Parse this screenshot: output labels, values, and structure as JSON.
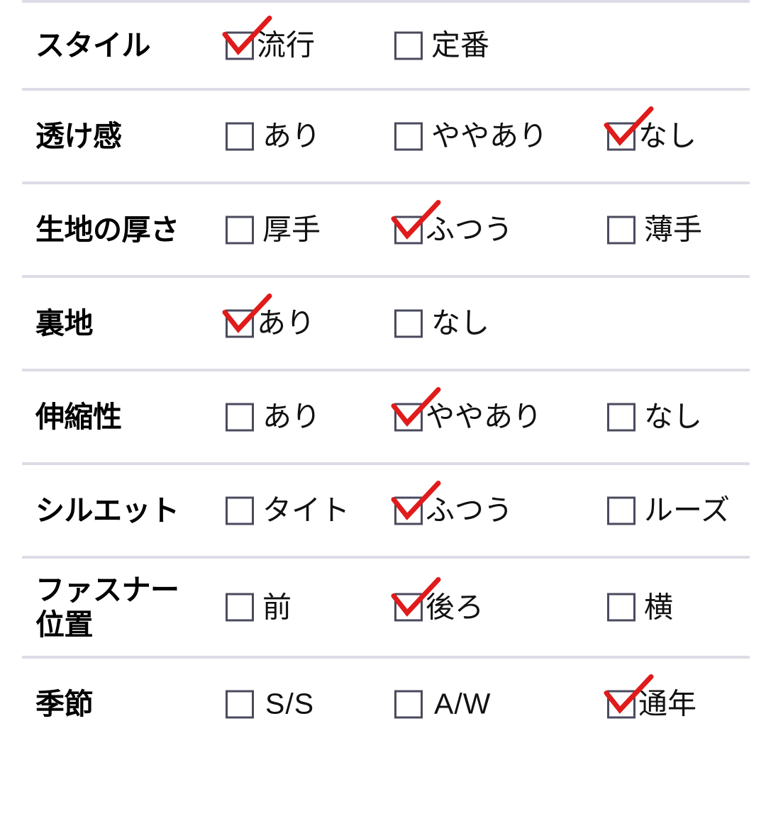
{
  "theme": {
    "background": "#ffffff",
    "divider_color": "#dcdce6",
    "checkbox_border_color": "#4a4a5e",
    "check_color": "#e01b1b",
    "label_color": "#000000",
    "option_text_color": "#111111"
  },
  "rows": [
    {
      "label": "スタイル",
      "options": [
        {
          "label": "流行",
          "checked": true,
          "script": "jp"
        },
        {
          "label": "定番",
          "checked": false,
          "script": "jp"
        }
      ]
    },
    {
      "label": "透け感",
      "options": [
        {
          "label": "あり",
          "checked": false,
          "script": "jp"
        },
        {
          "label": "ややあり",
          "checked": false,
          "script": "jp"
        },
        {
          "label": "なし",
          "checked": true,
          "script": "jp"
        }
      ]
    },
    {
      "label": "生地の厚さ",
      "options": [
        {
          "label": "厚手",
          "checked": false,
          "script": "jp"
        },
        {
          "label": "ふつう",
          "checked": true,
          "script": "jp"
        },
        {
          "label": "薄手",
          "checked": false,
          "script": "jp"
        }
      ]
    },
    {
      "label": "裏地",
      "options": [
        {
          "label": "あり",
          "checked": true,
          "script": "jp"
        },
        {
          "label": "なし",
          "checked": false,
          "script": "jp"
        }
      ]
    },
    {
      "label": "伸縮性",
      "options": [
        {
          "label": "あり",
          "checked": false,
          "script": "jp"
        },
        {
          "label": "ややあり",
          "checked": true,
          "script": "jp"
        },
        {
          "label": "なし",
          "checked": false,
          "script": "jp"
        }
      ]
    },
    {
      "label": "シルエット",
      "options": [
        {
          "label": "タイト",
          "checked": false,
          "script": "jp"
        },
        {
          "label": "ふつう",
          "checked": true,
          "script": "jp"
        },
        {
          "label": "ルーズ",
          "checked": false,
          "script": "jp"
        }
      ]
    },
    {
      "label": "ファスナー\n位置",
      "options": [
        {
          "label": "前",
          "checked": false,
          "script": "jp"
        },
        {
          "label": "後ろ",
          "checked": true,
          "script": "jp"
        },
        {
          "label": "横",
          "checked": false,
          "script": "jp"
        }
      ]
    },
    {
      "label": "季節",
      "options": [
        {
          "label": "S/S",
          "checked": false,
          "script": "latin"
        },
        {
          "label": "A/W",
          "checked": false,
          "script": "latin"
        },
        {
          "label": "通年",
          "checked": true,
          "script": "jp"
        }
      ]
    }
  ]
}
